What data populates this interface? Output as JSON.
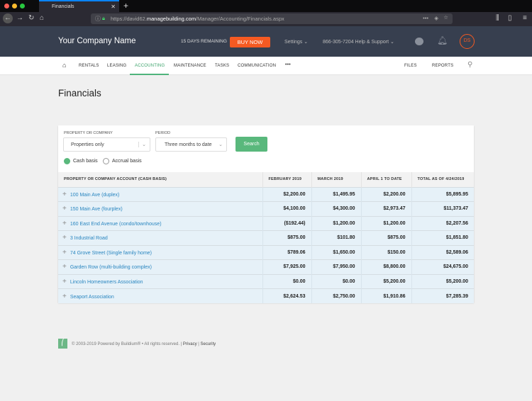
{
  "browser": {
    "tab_title": "Financials",
    "url_prefix": "https://david62.",
    "url_domain": "managebuilding.com",
    "url_path": "/Manager/Accounting/Financials.aspx"
  },
  "header": {
    "company": "Your Company Name",
    "days_remaining": "15 DAYS REMAINING",
    "buy_now": "BUY NOW",
    "settings": "Settings",
    "help": "866-305-7204 Help & Support",
    "avatar": "DS"
  },
  "nav": {
    "items": [
      "RENTALS",
      "LEASING",
      "ACCOUNTING",
      "MAINTENANCE",
      "TASKS",
      "COMMUNICATION"
    ],
    "more": "•••",
    "files": "FILES",
    "reports": "REPORTS",
    "active": "ACCOUNTING"
  },
  "page": {
    "title": "Financials"
  },
  "filters": {
    "property_label": "PROPERTY OR COMPANY",
    "property_value": "Properties only",
    "period_label": "PERIOD",
    "period_value": "Three months to date",
    "search": "Search",
    "cash": "Cash basis",
    "accrual": "Accrual basis",
    "selected": "Cash basis"
  },
  "table": {
    "headers": [
      "PROPERTY OR COMPANY ACCOUNT (CASH BASIS)",
      "FEBRUARY 2019",
      "MARCH 2019",
      "APRIL 1 TO DATE",
      "TOTAL AS OF 4/24/2019"
    ],
    "rows": [
      [
        "100 Main Ave (duplex)",
        "$2,200.00",
        "$1,495.95",
        "$2,200.00",
        "$5,895.95"
      ],
      [
        "150 Main Ave (fourplex)",
        "$4,100.00",
        "$4,300.00",
        "$2,973.47",
        "$11,373.47"
      ],
      [
        "160 East End Avenue (condo/townhouse)",
        "($192.44)",
        "$1,200.00",
        "$1,200.00",
        "$2,207.56"
      ],
      [
        "3 Industrial Road",
        "$875.00",
        "$101.80",
        "$875.00",
        "$1,851.80"
      ],
      [
        "74 Grove Street (Single family home)",
        "$789.06",
        "$1,650.00",
        "$150.00",
        "$2,589.06"
      ],
      [
        "Garden Row (multi-building complex)",
        "$7,925.00",
        "$7,950.00",
        "$8,800.00",
        "$24,675.00"
      ],
      [
        "Lincoln Homeowners Association",
        "$0.00",
        "$0.00",
        "$5,200.00",
        "$5,200.00"
      ],
      [
        "Seaport Association",
        "$2,624.53",
        "$2,750.00",
        "$1,910.86",
        "$7,285.39"
      ]
    ]
  },
  "footer": {
    "copyright": "© 2003-2019 Powered by Buildium® • All rights reserved. |",
    "privacy": "Privacy",
    "security": "Security"
  }
}
